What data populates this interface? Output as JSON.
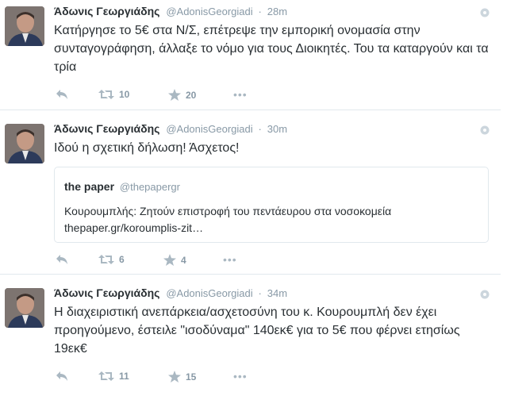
{
  "tweets": [
    {
      "name": "Άδωνις Γεωργιάδης",
      "handle": "@AdonisGeorgiadi",
      "separator": "·",
      "time": "28m",
      "text": "Κατήργησε το 5€ στα Ν/Σ, επέτρεψε την εμπορική ονομασία στην συνταγογράφηση, άλλαξε το νόμο για τους Διοικητές. Του τα καταργούν και τα τρία",
      "retweets": "10",
      "favorites": "20"
    },
    {
      "name": "Άδωνις Γεωργιάδης",
      "handle": "@AdonisGeorgiadi",
      "separator": "·",
      "time": "30m",
      "text": "Ιδού η σχετική δήλωση! Άσχετος!",
      "retweets": "6",
      "favorites": "4",
      "quoted": {
        "name": "the paper",
        "handle": "@thepapergr",
        "text": "Κουρουμπλής: Ζητούν επιστροφή του πεντάευρου στα νοσοκομεία",
        "link": "thepaper.gr/koroumplis-zit…"
      }
    },
    {
      "name": "Άδωνις Γεωργιάδης",
      "handle": "@AdonisGeorgiadi",
      "separator": "·",
      "time": "34m",
      "text": "Η διαχειριστική ανεπάρκεια/ασχετοσύνη του κ. Κουρουμπλή δεν έχει προηγούμενο, έστειλε \"ισοδύναμα\" 140εκ€ για το 5€ που φέρνει ετησίως 19εκ€",
      "retweets": "11",
      "favorites": "15"
    }
  ],
  "icons": {
    "reply": "reply-icon",
    "retweet": "retweet-icon",
    "favorite": "star-icon",
    "more": "more-icon",
    "settings": "gear-icon"
  },
  "colors": {
    "text": "#292f33",
    "muted": "#8899a6",
    "icon": "#aab8c2",
    "divider": "#e1e8ed"
  }
}
